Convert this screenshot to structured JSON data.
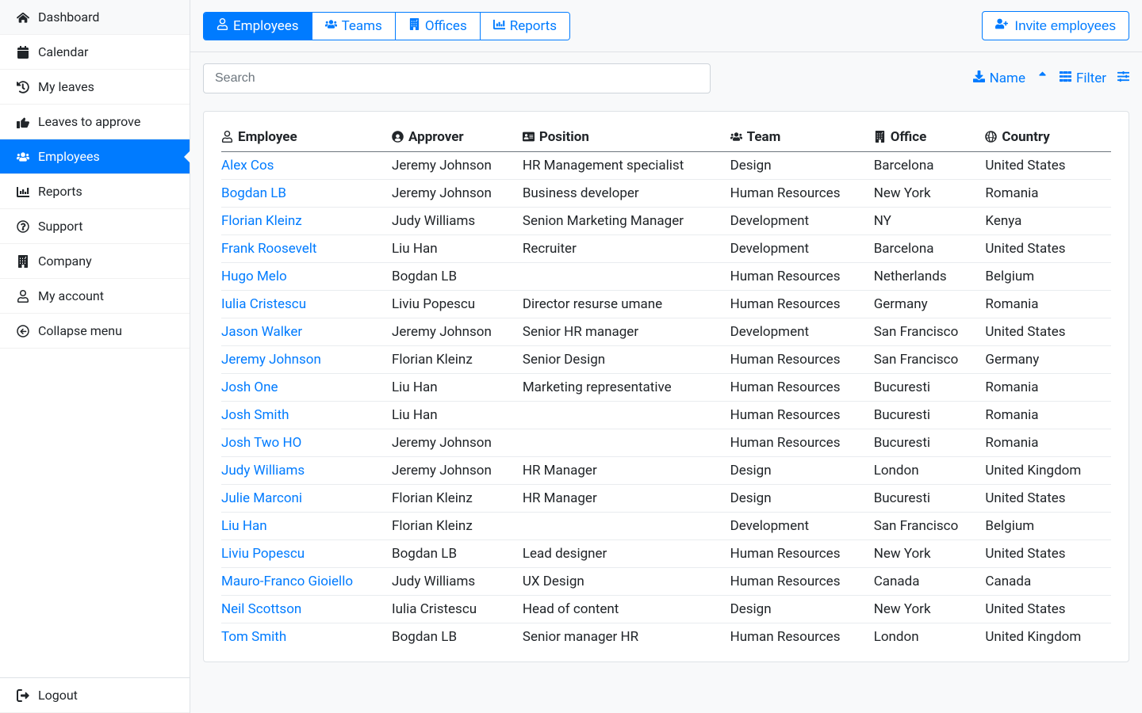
{
  "sidebar": {
    "items": [
      {
        "label": "Dashboard",
        "icon": "home-icon"
      },
      {
        "label": "Calendar",
        "icon": "calendar-icon"
      },
      {
        "label": "My leaves",
        "icon": "history-icon"
      },
      {
        "label": "Leaves to approve",
        "icon": "thumbs-up-icon"
      },
      {
        "label": "Employees",
        "icon": "users-icon",
        "active": true
      },
      {
        "label": "Reports",
        "icon": "chart-bar-icon"
      },
      {
        "label": "Support",
        "icon": "question-circle-icon"
      },
      {
        "label": "Company",
        "icon": "building-icon"
      },
      {
        "label": "My account",
        "icon": "user-icon"
      },
      {
        "label": "Collapse menu",
        "icon": "arrow-circle-left-icon"
      }
    ],
    "footer": {
      "label": "Logout",
      "icon": "sign-out-icon"
    }
  },
  "topbar": {
    "tabs": [
      {
        "label": "Employees",
        "icon": "user-icon",
        "active": true
      },
      {
        "label": "Teams",
        "icon": "users-icon"
      },
      {
        "label": "Offices",
        "icon": "building-icon"
      },
      {
        "label": "Reports",
        "icon": "chart-bar-icon"
      }
    ],
    "invite_label": "Invite employees"
  },
  "toolbar": {
    "search_placeholder": "Search",
    "download_label": "Name",
    "filter_label": "Filter"
  },
  "table": {
    "columns": [
      {
        "label": "Employee",
        "icon": "user-icon"
      },
      {
        "label": "Approver",
        "icon": "user-circle-icon"
      },
      {
        "label": "Position",
        "icon": "id-card-icon"
      },
      {
        "label": "Team",
        "icon": "users-icon"
      },
      {
        "label": "Office",
        "icon": "building-icon"
      },
      {
        "label": "Country",
        "icon": "globe-icon"
      }
    ],
    "rows": [
      {
        "employee": "Alex Cos",
        "approver": "Jeremy Johnson",
        "position": "HR Management specialist",
        "team": "Design",
        "office": "Barcelona",
        "country": "United States"
      },
      {
        "employee": "Bogdan LB",
        "approver": "Jeremy Johnson",
        "position": "Business developer",
        "team": "Human Resources",
        "office": "New York",
        "country": "Romania"
      },
      {
        "employee": "Florian Kleinz",
        "approver": "Judy Williams",
        "position": "Senion Marketing Manager",
        "team": "Development",
        "office": "NY",
        "country": "Kenya"
      },
      {
        "employee": "Frank Roosevelt",
        "approver": "Liu Han",
        "position": "Recruiter",
        "team": "Development",
        "office": "Barcelona",
        "country": "United States"
      },
      {
        "employee": "Hugo Melo",
        "approver": "Bogdan LB",
        "position": "",
        "team": "Human Resources",
        "office": "Netherlands",
        "country": "Belgium"
      },
      {
        "employee": "Iulia Cristescu",
        "approver": "Liviu Popescu",
        "position": "Director resurse umane",
        "team": "Human Resources",
        "office": "Germany",
        "country": "Romania"
      },
      {
        "employee": "Jason Walker",
        "approver": "Jeremy Johnson",
        "position": "Senior HR manager",
        "team": "Development",
        "office": "San Francisco",
        "country": "United States"
      },
      {
        "employee": "Jeremy Johnson",
        "approver": "Florian Kleinz",
        "position": "Senior Design",
        "team": "Human Resources",
        "office": "San Francisco",
        "country": "Germany"
      },
      {
        "employee": "Josh One",
        "approver": "Liu Han",
        "position": "Marketing representative",
        "team": "Human Resources",
        "office": "Bucuresti",
        "country": "Romania"
      },
      {
        "employee": "Josh Smith",
        "approver": "Liu Han",
        "position": "",
        "team": "Human Resources",
        "office": "Bucuresti",
        "country": "Romania"
      },
      {
        "employee": "Josh Two HO",
        "approver": "Jeremy Johnson",
        "position": "",
        "team": "Human Resources",
        "office": "Bucuresti",
        "country": "Romania"
      },
      {
        "employee": "Judy Williams",
        "approver": "Jeremy Johnson",
        "position": "HR Manager",
        "team": "Design",
        "office": "London",
        "country": "United Kingdom"
      },
      {
        "employee": "Julie Marconi",
        "approver": "Florian Kleinz",
        "position": "HR Manager",
        "team": "Design",
        "office": "Bucuresti",
        "country": "United States"
      },
      {
        "employee": "Liu Han",
        "approver": "Florian Kleinz",
        "position": "",
        "team": "Development",
        "office": "San Francisco",
        "country": "Belgium"
      },
      {
        "employee": "Liviu Popescu",
        "approver": "Bogdan LB",
        "position": "Lead designer",
        "team": "Human Resources",
        "office": "New York",
        "country": "United States"
      },
      {
        "employee": "Mauro-Franco Gioiello",
        "approver": "Judy Williams",
        "position": "UX Design",
        "team": "Human Resources",
        "office": "Canada",
        "country": "Canada"
      },
      {
        "employee": "Neil Scottson",
        "approver": "Iulia Cristescu",
        "position": "Head of content",
        "team": "Design",
        "office": "New York",
        "country": "United States"
      },
      {
        "employee": "Tom Smith",
        "approver": "Bogdan LB",
        "position": "Senior manager HR",
        "team": "Human Resources",
        "office": "London",
        "country": "United Kingdom"
      }
    ]
  }
}
